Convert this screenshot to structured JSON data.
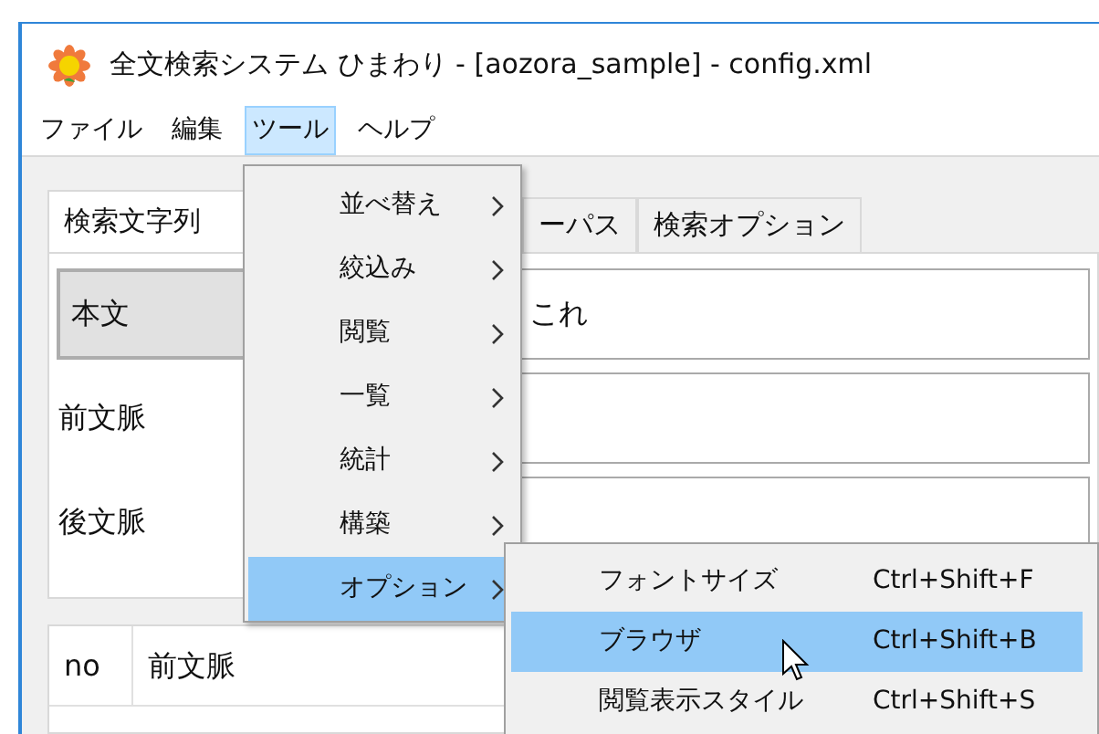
{
  "window": {
    "title": "全文検索システム ひまわり - [aozora_sample] - config.xml"
  },
  "menu_bar": [
    {
      "label": "ファイル",
      "selected": false
    },
    {
      "label": "編集",
      "selected": false
    },
    {
      "label": "ツール",
      "selected": true
    },
    {
      "label": "ヘルプ",
      "selected": false
    }
  ],
  "tabs": [
    {
      "label": "検索文字列",
      "selected": true
    },
    {
      "label": "ーパス",
      "selected": false
    },
    {
      "label": "検索オプション",
      "selected": false
    }
  ],
  "search_rows": [
    {
      "label": "本文",
      "kind": "button",
      "value": "これ"
    },
    {
      "label": "前文脈",
      "kind": "label"
    },
    {
      "label": "後文脈",
      "kind": "label"
    }
  ],
  "table": {
    "columns": [
      "no",
      "前文脈"
    ]
  },
  "tools_menu": [
    {
      "label": "並べ替え",
      "selected": false
    },
    {
      "label": "絞込み",
      "selected": false
    },
    {
      "label": "閲覧",
      "selected": false
    },
    {
      "label": "一覧",
      "selected": false
    },
    {
      "label": "統計",
      "selected": false
    },
    {
      "label": "構築",
      "selected": false
    },
    {
      "label": "オプション",
      "selected": true
    }
  ],
  "options_submenu": [
    {
      "label": "フォントサイズ",
      "shortcut": "Ctrl+Shift+F",
      "selected": false
    },
    {
      "label": "ブラウザ",
      "shortcut": "Ctrl+Shift+B",
      "selected": true
    },
    {
      "label": "閲覧表示スタイル",
      "shortcut": "Ctrl+Shift+S",
      "selected": false
    }
  ]
}
